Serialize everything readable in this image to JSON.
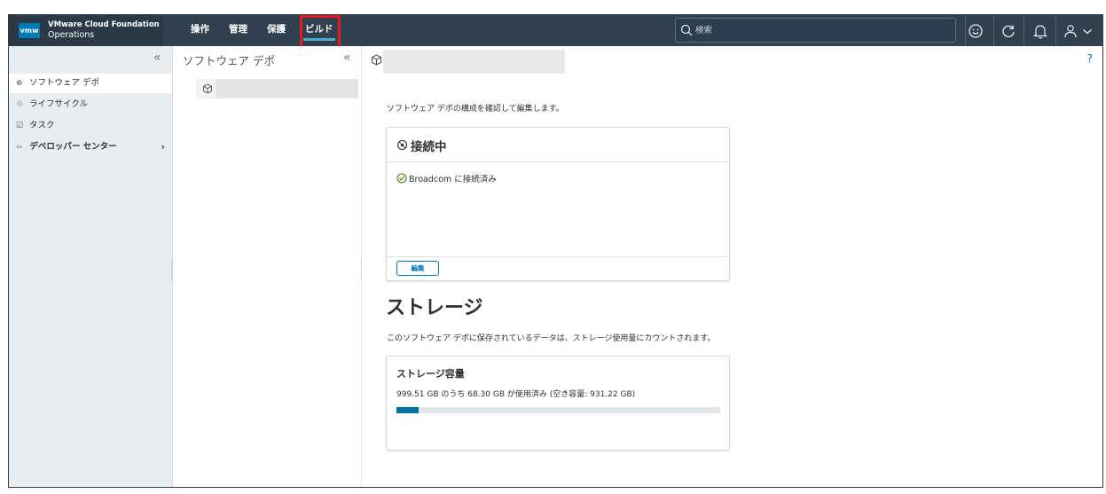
{
  "header": {
    "logo": "vmw",
    "product_line1": "VMware Cloud Foundation",
    "product_line2": "Operations",
    "nav": [
      {
        "label": "操作",
        "active": false
      },
      {
        "label": "管理",
        "active": false
      },
      {
        "label": "保護",
        "active": false
      },
      {
        "label": "ビルド",
        "active": true
      }
    ],
    "search_placeholder": "検索",
    "icons": [
      "smiley-icon",
      "refresh-icon",
      "bell-icon",
      "user-icon",
      "chevron-down-icon"
    ]
  },
  "leftnav": {
    "collapse_glyph": "«",
    "items": [
      {
        "label": "ソフトウェア デポ",
        "selected": true
      },
      {
        "label": "ライフサイクル",
        "selected": false
      },
      {
        "label": "タスク",
        "selected": false
      },
      {
        "label": "デベロッパー センター",
        "selected": false,
        "chevron": "›"
      }
    ]
  },
  "midpanel": {
    "title": "ソフトウェア デポ",
    "collapse_glyph": "«"
  },
  "main": {
    "help": "?",
    "description": "ソフトウェア デポの構成を確認して編集します。",
    "connection_card": {
      "title": "接続中",
      "status": "Broadcom に接続済み",
      "edit_label": "編集"
    },
    "storage_heading": "ストレージ",
    "storage_description": "このソフトウェア デポに保存されているデータは、ストレージ使用量にカウントされます。",
    "storage_card": {
      "title": "ストレージ容量",
      "usage_text": "999.51 GB のうち 68.30 GB が使用済み (空き容量: 931.22 GB)",
      "used_fraction": 0.0683
    }
  },
  "colors": {
    "header_bg": "#30404e",
    "accent": "#0079b8",
    "progress_fill": "#0072a3",
    "highlight_box": "#e4191f"
  }
}
